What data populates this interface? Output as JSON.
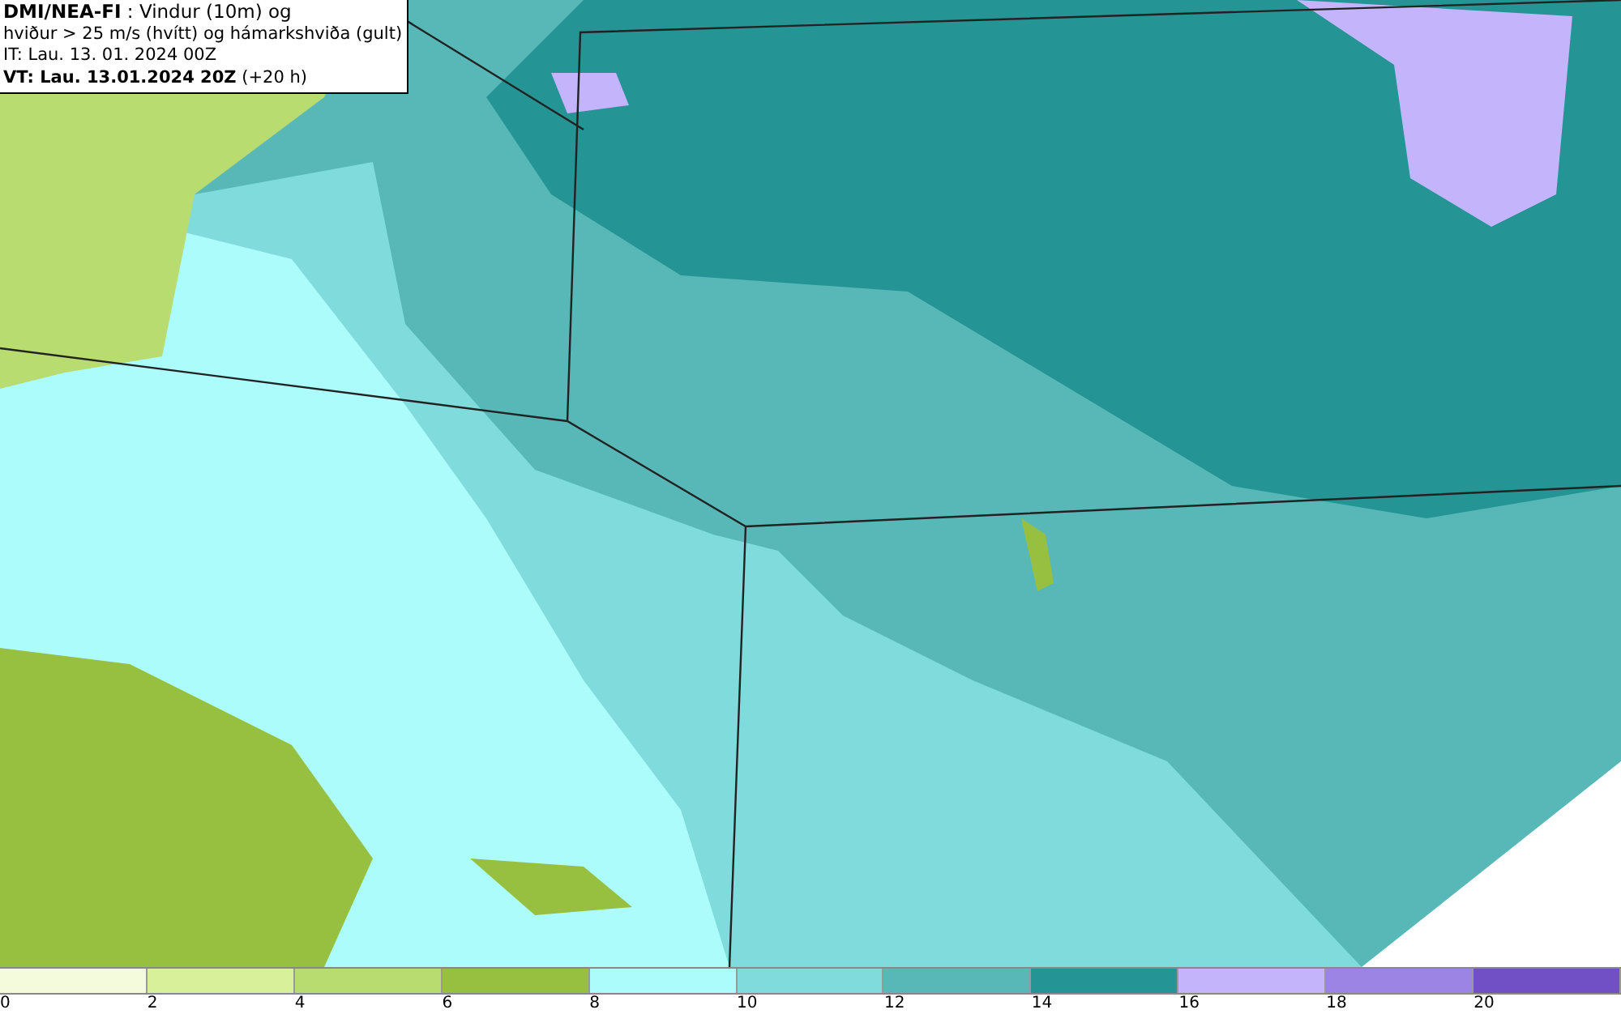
{
  "title_box": {
    "lines": [
      "**DMI/NEA-FI** : Vindur (10m) og",
      "hviður > 25 m/s (hvítt) og hámarkshviða (gult)",
      "IT: Lau. 13. 01. 2024 00Z",
      "**VT: Lau. 13.01.2024 20Z** (+20 h)"
    ]
  },
  "legend": {
    "bins": [
      {
        "color": "#f4fadc"
      },
      {
        "color": "#d8f09a"
      },
      {
        "color": "#b8dc70"
      },
      {
        "color": "#98c040"
      },
      {
        "color": "#acfcfc"
      },
      {
        "color": "#80dcdc"
      },
      {
        "color": "#58b8b8"
      },
      {
        "color": "#249494"
      },
      {
        "color": "#c4b4fc"
      },
      {
        "color": "#9c84e4"
      },
      {
        "color": "#7050c4"
      }
    ],
    "ticks": [
      "0",
      "2",
      "4",
      "6",
      "8",
      "10",
      "12",
      "14",
      "16",
      "18",
      "20"
    ]
  }
}
